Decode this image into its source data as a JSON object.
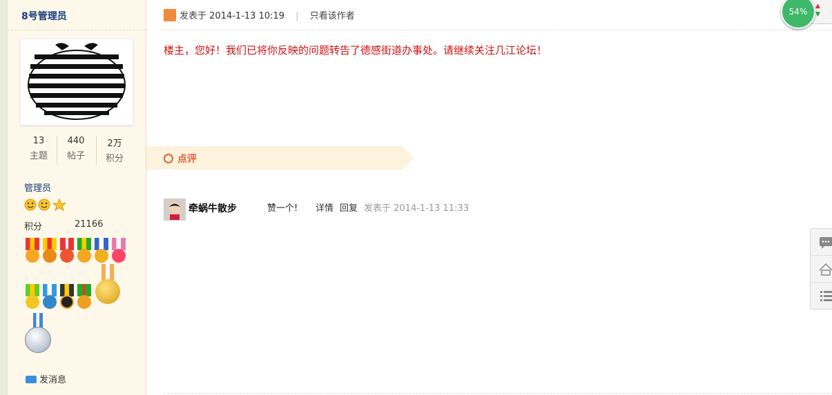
{
  "author": {
    "name": "8号管理员",
    "stats": [
      {
        "num": "13",
        "label": "主题"
      },
      {
        "num": "440",
        "label": "帖子"
      },
      {
        "num": "2万",
        "label": "积分"
      }
    ],
    "rank": "管理员",
    "credits_label": "积分",
    "credits_value": "21166",
    "send_message": "发消息"
  },
  "post": {
    "posted_prefix": "发表于",
    "posted_date": "2014-1-13 10:19",
    "separator": "|",
    "only_author": "只看该作者",
    "content": "楼主，您好！我们已将你反映的问题转告了德感街道办事处。请继续关注几江论坛！"
  },
  "review": {
    "title": "点评",
    "comment": {
      "user": "牵蜗牛散步",
      "text": "赞一个!",
      "detail": "详情",
      "reply": "回复",
      "posted": "发表于 2014-1-13 11:33"
    }
  },
  "widget": {
    "percent": "54%"
  },
  "colors": {
    "accent_red": "#cc1111",
    "review_orange": "#e0603a",
    "sidebar_bg": "#fdf8ea"
  }
}
